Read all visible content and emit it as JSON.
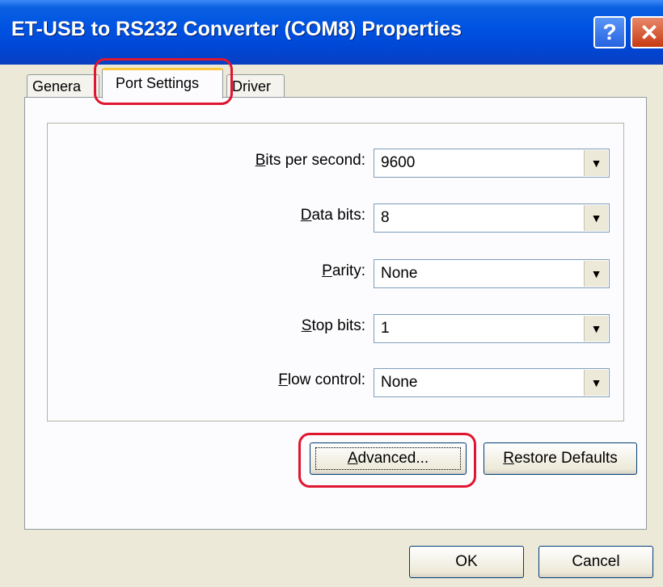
{
  "window": {
    "title": "ET-USB to RS232 Converter (COM8) Properties",
    "help_glyph": "?",
    "close_glyph": "✕"
  },
  "tabs": [
    {
      "label": "Genera",
      "selected": false
    },
    {
      "label": "Port Settings",
      "selected": true
    },
    {
      "label": "Driver",
      "selected": false
    }
  ],
  "settings": [
    {
      "label_key": "B",
      "label_rest": "its per second:",
      "value": "9600"
    },
    {
      "label_key": "D",
      "label_rest": "ata bits:",
      "value": "8"
    },
    {
      "label_key": "P",
      "label_rest": "arity:",
      "value": "None"
    },
    {
      "label_key": "S",
      "label_rest": "top bits:",
      "value": "1"
    },
    {
      "label_key": "F",
      "label_rest": "low control:",
      "value": "None"
    }
  ],
  "buttons": {
    "advanced_key": "A",
    "advanced_rest": "dvanced...",
    "restore_key": "R",
    "restore_rest": "estore Defaults",
    "ok": "OK",
    "cancel": "Cancel"
  },
  "colors": {
    "titlebar": "#0054e3",
    "highlight": "#e01530",
    "tab_accent": "#ffc83c"
  },
  "icons": {
    "dropdown": "chevron-down-icon"
  }
}
